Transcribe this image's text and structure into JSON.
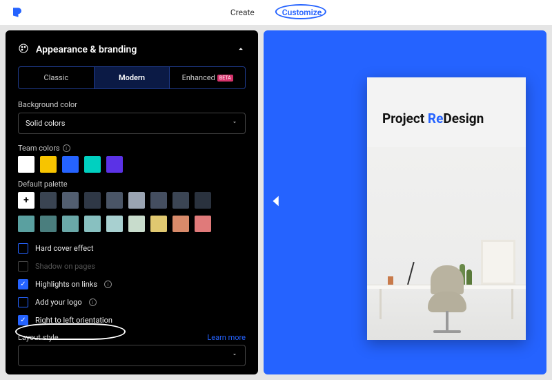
{
  "nav": {
    "create": "Create",
    "customize": "Customize"
  },
  "section": {
    "title": "Appearance & branding"
  },
  "themeTabs": {
    "classic": "Classic",
    "modern": "Modern",
    "enhanced": "Enhanced",
    "enhancedBadge": "BETA"
  },
  "bgColor": {
    "label": "Background color",
    "value": "Solid colors"
  },
  "teamColors": {
    "label": "Team colors",
    "swatches": [
      "#ffffff",
      "#f7c400",
      "#2563ff",
      "#00d0c0",
      "#5b32e6"
    ]
  },
  "defaultPalette": {
    "label": "Default palette",
    "row1": [
      "add",
      "#3a4452",
      "#525e70",
      "#2f3846",
      "#4a5566",
      "#9aa4b2",
      "#444e60",
      "#3b4554",
      "#2a323e"
    ],
    "row2": [
      "#5aa0a0",
      "#4a7e7e",
      "#6aa8a8",
      "#88c0c0",
      "#a8d0d0",
      "#c8dccc",
      "#e0c870",
      "#d88a6a",
      "#e07a7a"
    ]
  },
  "options": {
    "hardCover": "Hard cover effect",
    "shadow": "Shadow on pages",
    "highlights": "Highlights on links",
    "logo": "Add your logo",
    "rtl": "Right to left orientation"
  },
  "layout": {
    "label": "Layout style",
    "learnMore": "Learn more",
    "value": ""
  },
  "preview": {
    "titlePrefix": "Project ",
    "titleAccent": "Re",
    "titleSuffix": "Design"
  }
}
